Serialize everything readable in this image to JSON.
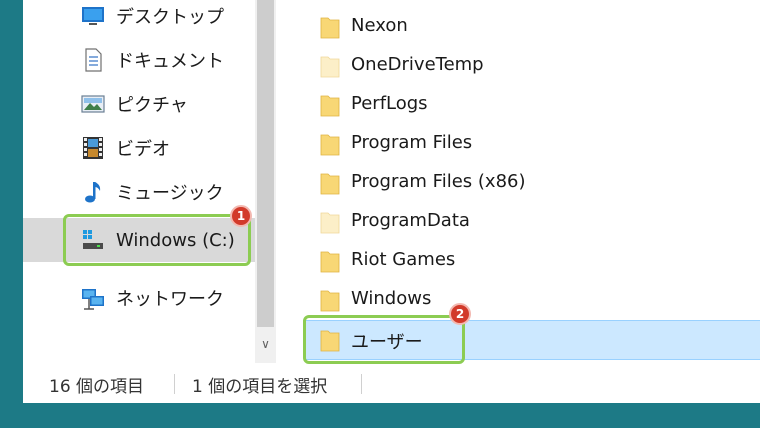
{
  "nav": {
    "items": [
      {
        "label": "デスクトップ",
        "icon": "desktop-icon"
      },
      {
        "label": "ドキュメント",
        "icon": "documents-icon"
      },
      {
        "label": "ピクチャ",
        "icon": "pictures-icon"
      },
      {
        "label": "ビデオ",
        "icon": "videos-icon"
      },
      {
        "label": "ミュージック",
        "icon": "music-icon"
      },
      {
        "label": "Windows (C:)",
        "icon": "drive-icon",
        "selected": true
      },
      {
        "label": "ネットワーク",
        "icon": "network-icon"
      }
    ]
  },
  "files": [
    {
      "name": "Nexon",
      "faded": false
    },
    {
      "name": "OneDriveTemp",
      "faded": true
    },
    {
      "name": "PerfLogs",
      "faded": false
    },
    {
      "name": "Program Files",
      "faded": false
    },
    {
      "name": "Program Files (x86)",
      "faded": false
    },
    {
      "name": "ProgramData",
      "faded": true
    },
    {
      "name": "Riot Games",
      "faded": false
    },
    {
      "name": "Windows",
      "faded": false
    },
    {
      "name": "ユーザー",
      "faded": false,
      "selected": true
    }
  ],
  "status": {
    "item_count": "16 個の項目",
    "selected_count": "1 個の項目を選択"
  },
  "markers": {
    "first": "1",
    "second": "2"
  },
  "colors": {
    "highlight": "#8ccc52",
    "marker": "#d23a2a",
    "selection": "#cce8ff",
    "folder": "#f8d775"
  }
}
